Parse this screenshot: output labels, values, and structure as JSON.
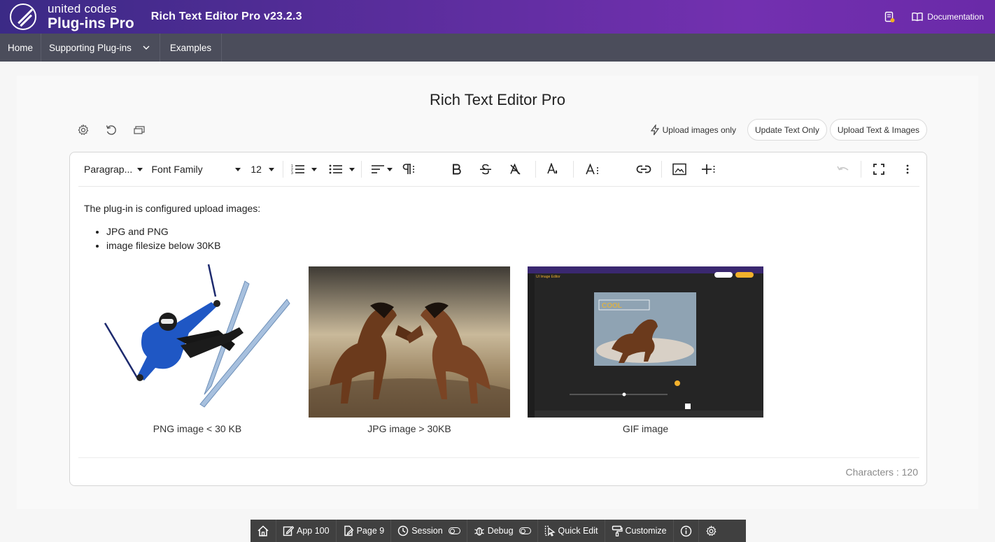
{
  "header": {
    "logo_top": "united codes",
    "logo_bottom": "Plug-ins Pro",
    "app_title": "Rich Text Editor Pro v23.2.3",
    "documentation_label": "Documentation"
  },
  "nav": {
    "items": [
      {
        "label": "Home"
      },
      {
        "label": "Supporting Plug-ins"
      },
      {
        "label": "Examples"
      }
    ]
  },
  "page": {
    "title": "Rich Text Editor Pro"
  },
  "actions": {
    "upload_only_label": "Upload images only",
    "update_text_label": "Update Text Only",
    "upload_text_images_label": "Upload Text & Images"
  },
  "toolbar": {
    "paragraph": "Paragrap...",
    "font_family": "Font Family",
    "font_size": "12"
  },
  "content": {
    "intro": "The plug-in is configured upload images:",
    "bullets": [
      "JPG and PNG",
      "image filesize below 30KB"
    ],
    "captions": [
      "PNG image < 30 KB",
      "JPG image > 30KB",
      "GIF image"
    ]
  },
  "editor_footer": {
    "characters": "Characters : 120"
  },
  "devbar": {
    "items": [
      "App 100",
      "Page 9",
      "Session",
      "Debug",
      "Quick Edit",
      "Customize"
    ]
  },
  "colors": {
    "header_start": "#3b2a86",
    "header_end": "#7330b0",
    "nav_bg": "#4b4d5b",
    "devbar_bg": "#404040"
  }
}
